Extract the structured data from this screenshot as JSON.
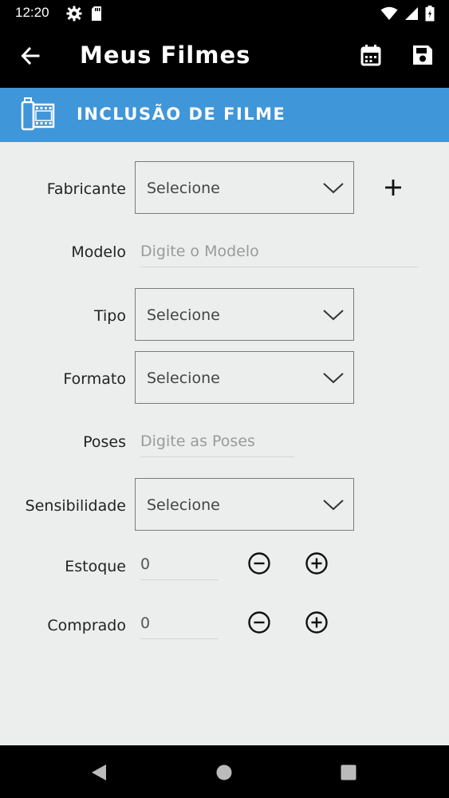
{
  "status_bar": {
    "time": "12:20",
    "icons_left": [
      "gear-icon",
      "sdcard-icon"
    ],
    "icons_right": [
      "wifi-icon",
      "signal-icon",
      "battery-icon"
    ]
  },
  "app_bar": {
    "title": "Meus Filmes",
    "actions": [
      "calendar-icon",
      "save-icon"
    ]
  },
  "section": {
    "title": "INCLUSÃO DE FILME",
    "color": "#3f96d9"
  },
  "form": {
    "fabricante": {
      "label": "Fabricante",
      "value": "Selecione"
    },
    "modelo": {
      "label": "Modelo",
      "placeholder": "Digite o Modelo"
    },
    "tipo": {
      "label": "Tipo",
      "value": "Selecione"
    },
    "formato": {
      "label": "Formato",
      "value": "Selecione"
    },
    "poses": {
      "label": "Poses",
      "placeholder": "Digite as Poses"
    },
    "sensibilidade": {
      "label": "Sensibilidade",
      "value": "Selecione"
    },
    "estoque": {
      "label": "Estoque",
      "value": "0"
    },
    "comprado": {
      "label": "Comprado",
      "value": "0"
    }
  },
  "nav_bar": {
    "buttons": [
      "back-icon",
      "home-icon",
      "recents-icon"
    ]
  }
}
